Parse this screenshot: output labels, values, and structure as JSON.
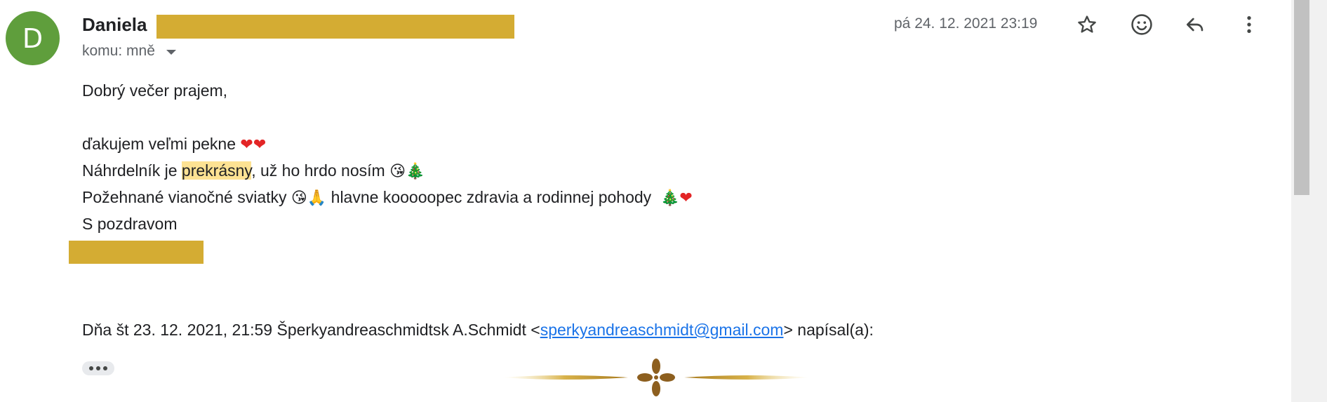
{
  "message": {
    "avatar_letter": "D",
    "sender_name": "Daniela",
    "recipient_label": "komu: mně",
    "date": "pá 24. 12. 2021 23:19",
    "body": {
      "greeting": "Dobrý večer prajem,",
      "line_thanks": "ďakujem veľmi pekne ",
      "line_necklace_before": "Náhrdelník je ",
      "line_necklace_highlight": "prekrásny",
      "line_necklace_after": ", už ho hrdo nosím ",
      "line_wishes_before": "Požehnané vianočné sviatky ",
      "line_wishes_after": " hlavne kooooopec zdravia a rodinnej pohody  ",
      "closing": "S pozdravom"
    },
    "emojis": {
      "heart": "❤",
      "tree": "🎄",
      "kiss": "😘",
      "pray": "🙏"
    },
    "quote": {
      "prefix": "Dňa št 23. 12. 2021, 21:59 Šperkyandreaschmidtsk A.Schmidt <",
      "email": "sperkyandreaschmidt@gmail.com",
      "suffix": "> napísal(a):"
    }
  },
  "icons": {
    "star": "star-icon",
    "emoji": "emoji-icon",
    "reply": "reply-icon",
    "more": "more-vert-icon"
  },
  "colors": {
    "avatar_bg": "#5f9e3c",
    "redaction": "#d4ac33",
    "highlight": "#fde293",
    "link": "#1a73e8",
    "heart": "#e32526"
  }
}
